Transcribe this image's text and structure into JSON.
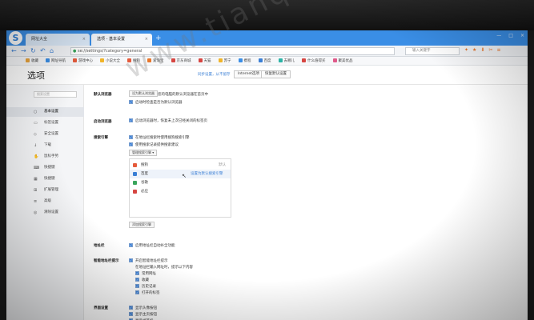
{
  "tabs": [
    {
      "label": "网址大全",
      "close": "×"
    },
    {
      "label": "选项 - 基本设置",
      "close": "×"
    }
  ],
  "new_tab": "+",
  "window_controls": [
    "—",
    "□",
    "×"
  ],
  "nav": {
    "back": "←",
    "forward": "→",
    "reload": "↻",
    "home": "⌂",
    "undo": "↶"
  },
  "address_bar": {
    "value": "se://settings/?category=general"
  },
  "search_box": {
    "placeholder": "输入关键字"
  },
  "bookmarks": [
    {
      "label": "收藏",
      "color": "#e8a33b"
    },
    {
      "label": "网址导航",
      "color": "#3a8ee6"
    },
    {
      "label": "游戏中心",
      "color": "#e55b3c"
    },
    {
      "label": "小说大全",
      "color": "#f0b429"
    },
    {
      "label": "搜狗",
      "color": "#e55b3c"
    },
    {
      "label": "爱淘宝",
      "color": "#e8762b"
    },
    {
      "label": "京东商城",
      "color": "#d64541"
    },
    {
      "label": "天猫",
      "color": "#d64541"
    },
    {
      "label": "苏宁",
      "color": "#f0b429"
    },
    {
      "label": "携程",
      "color": "#3a8ee6"
    },
    {
      "label": "百度",
      "color": "#3a7fd5"
    },
    {
      "label": "去哪儿",
      "color": "#2bb3a6"
    },
    {
      "label": "什么值得买",
      "color": "#d64541"
    },
    {
      "label": "聚美优品",
      "color": "#e05a8a"
    }
  ],
  "page": {
    "title": "选项",
    "sync_link": "同步设置，从不留存",
    "btn_ie": "Internet选项",
    "btn_restore": "恢复默认设置"
  },
  "sidebar": {
    "search_placeholder": "搜索设置",
    "items": [
      {
        "label": "基本设置",
        "icon": "○"
      },
      {
        "label": "标签设置",
        "icon": "▭"
      },
      {
        "label": "安全设置",
        "icon": "◇"
      },
      {
        "label": "下载",
        "icon": "↓"
      },
      {
        "label": "鼠标手势",
        "icon": "✋"
      },
      {
        "label": "快捷键",
        "icon": "⌨"
      },
      {
        "label": "快捷键",
        "icon": "▦"
      },
      {
        "label": "扩展管理",
        "icon": "⊞"
      },
      {
        "label": "高级",
        "icon": "≡"
      },
      {
        "label": "清除设置",
        "icon": "◎"
      }
    ]
  },
  "content": {
    "default_browser": {
      "label": "默认浏览器",
      "btn_set": "设为默认浏览器",
      "status": "您的电脑的默认浏览器在首页中",
      "check": "启动时检查是否为默认浏览器"
    },
    "browse_mode": {
      "label": "启动浏览器",
      "check": "启动浏览器时，恢复未上次已经关闭的标签页"
    },
    "search_engine": {
      "label": "搜索引擎",
      "check1": "在地址栏搜索时使用搜狗搜索引擎",
      "check2": "使用搜索记录提供搜索建议",
      "dropdown": "管理搜索引擎",
      "engines": [
        {
          "name": "搜狗",
          "color": "#e55b3c",
          "badge": "默认"
        },
        {
          "name": "百度",
          "color": "#3a7fd5",
          "badge": ""
        },
        {
          "name": "谷歌",
          "color": "#3aa55c",
          "badge": ""
        },
        {
          "name": "必应",
          "color": "#d64541",
          "badge": ""
        }
      ],
      "set_default": "设置为默认搜索引擎",
      "add_btn": "添加搜索引擎"
    },
    "address_bar": {
      "label": "地址栏",
      "check": "启用地址栏自动补全功能"
    },
    "smart_address": {
      "label": "智能地址栏提示",
      "check": "开启智能地址栏提示",
      "desc": "在地址栏输入网址时，提示以下内容",
      "options": [
        "常用网址",
        "收藏",
        "历史记录",
        "打开的标签"
      ]
    },
    "interface": {
      "label": "界面设置",
      "options": [
        "显示头像按钮",
        "显示主页按钮",
        "显示书签栏",
        "显示状态栏"
      ]
    }
  },
  "watermark": "www.tianqijun.com"
}
